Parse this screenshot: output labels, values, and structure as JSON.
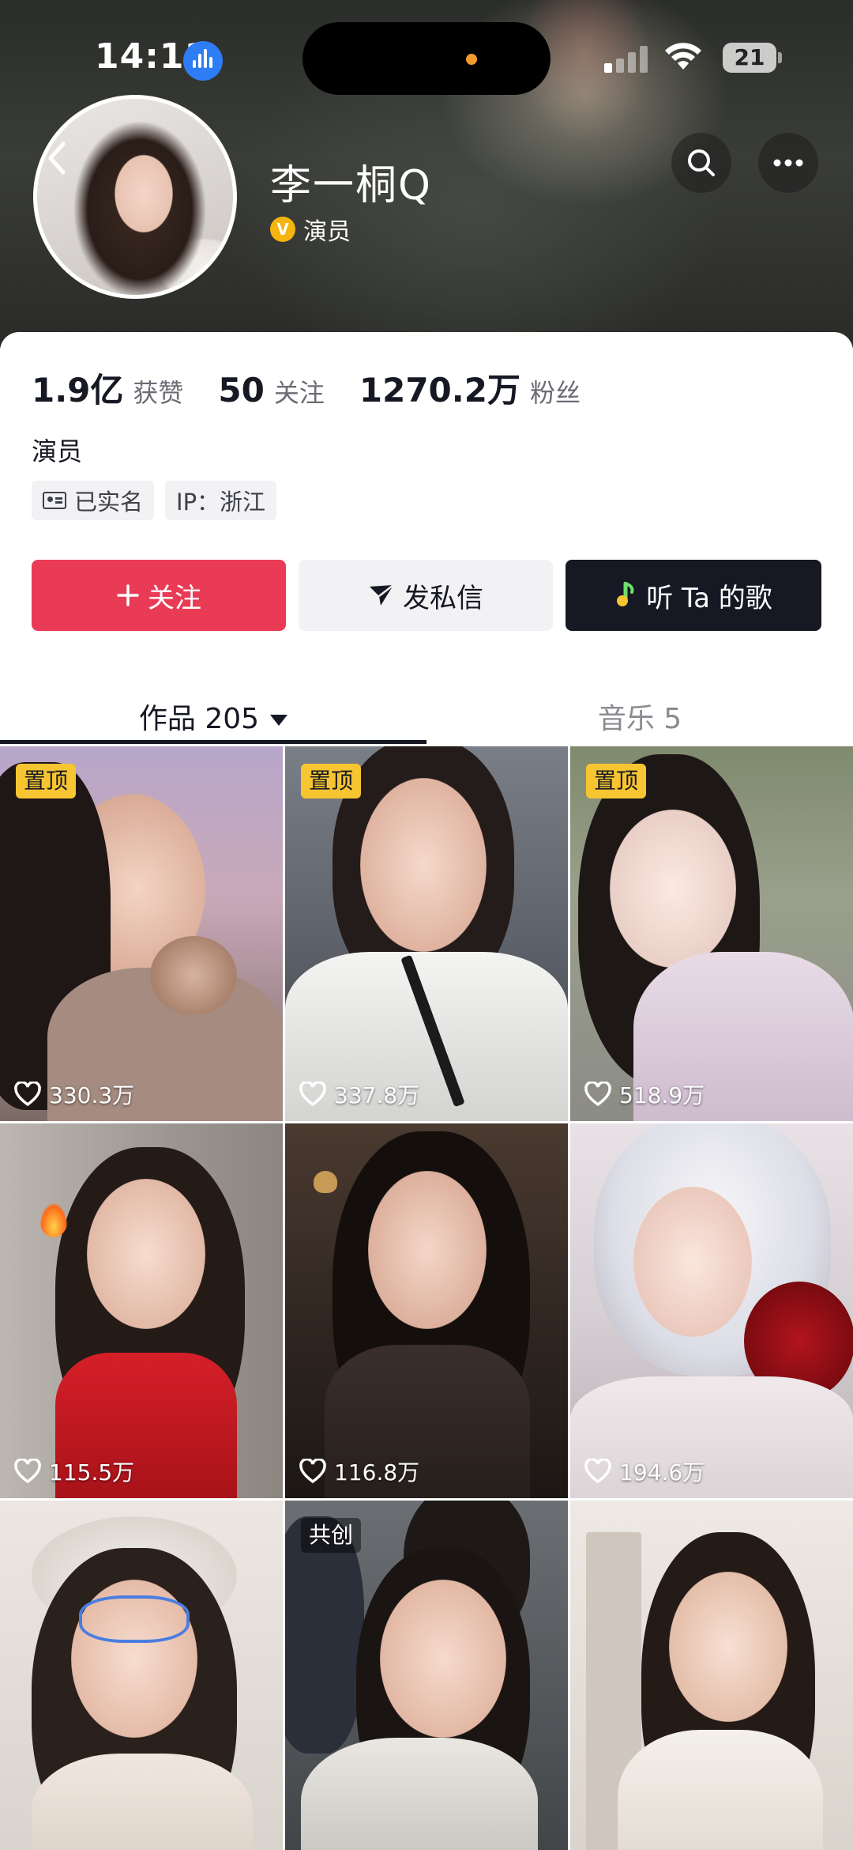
{
  "status": {
    "time": "14:11",
    "battery": "21"
  },
  "profile": {
    "name": "李一桐Q",
    "verify_badge": "V",
    "verify_label": "演员",
    "bio": "演员"
  },
  "stats": [
    {
      "value": "1.9亿",
      "label": "获赞"
    },
    {
      "value": "50",
      "label": "关注"
    },
    {
      "value": "1270.2万",
      "label": "粉丝"
    }
  ],
  "tags": {
    "realname": "已实名",
    "ip": "IP：浙江"
  },
  "actions": {
    "follow": "关注",
    "message": "发私信",
    "song": "听 Ta 的歌"
  },
  "tabs": {
    "works": "作品 205",
    "music": "音乐 5"
  },
  "videos": [
    {
      "likes": "330.3万",
      "badge": "置顶"
    },
    {
      "likes": "337.8万",
      "badge": "置顶"
    },
    {
      "likes": "518.9万",
      "badge": "置顶"
    },
    {
      "likes": "115.5万",
      "badge": ""
    },
    {
      "likes": "116.8万",
      "badge": ""
    },
    {
      "likes": "194.6万",
      "badge": ""
    },
    {
      "likes": "",
      "badge": ""
    },
    {
      "likes": "",
      "badge": "共创"
    },
    {
      "likes": "",
      "badge": ""
    }
  ],
  "colors": {
    "follow": "#ea3b56",
    "pin": "#f7c531",
    "dark": "#161823"
  }
}
